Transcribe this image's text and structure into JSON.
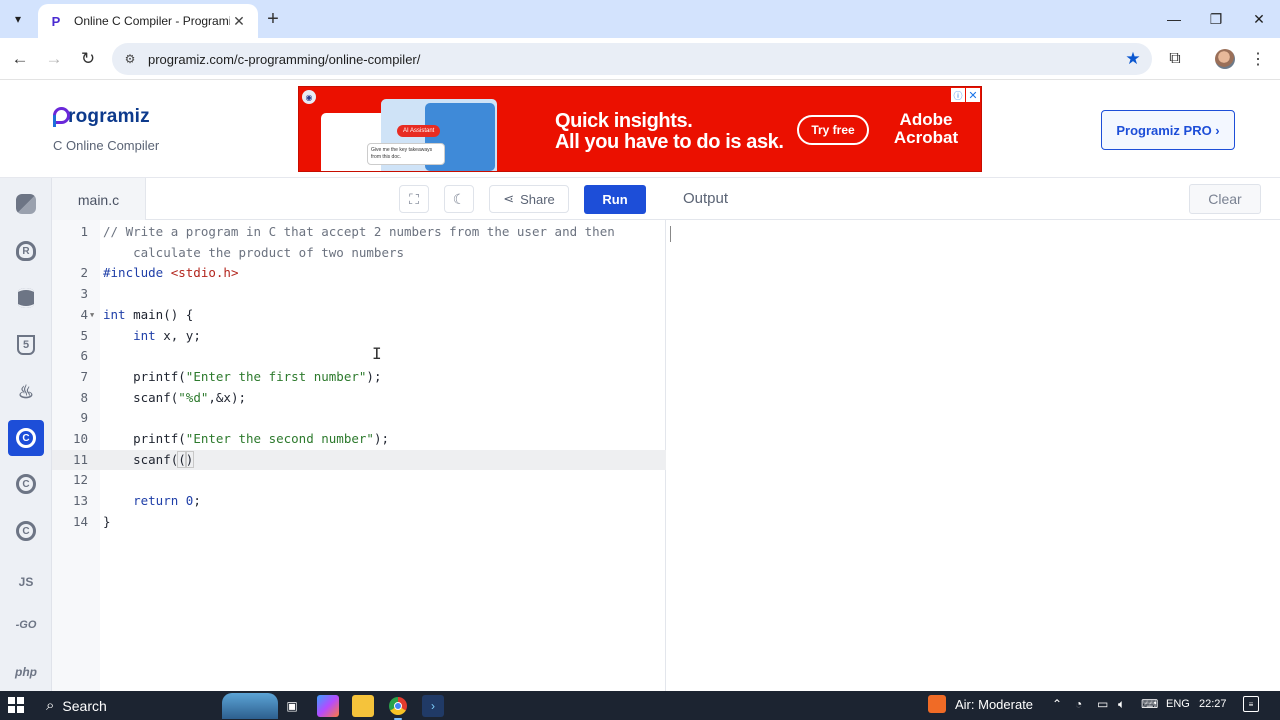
{
  "browser": {
    "tab_title": "Online C Compiler - Programiz",
    "url": "programiz.com/c-programming/online-compiler/"
  },
  "site": {
    "logo_text": "rogramiz",
    "subtitle": "C Online Compiler",
    "pro_button": "Programiz PRO ›"
  },
  "ad": {
    "headline_line1": "Quick insights.",
    "headline_line2": "All you have to do is ask.",
    "cta": "Try free",
    "brand_line1": "Adobe",
    "brand_line2": "Acrobat",
    "chip_text": "AI Assistant",
    "bubble_text": "Give me the key takeaways from this doc."
  },
  "sidebar": {
    "items": [
      {
        "name": "python",
        "icon": "python-icon",
        "label": ""
      },
      {
        "name": "r",
        "icon": "r-icon",
        "label": "R"
      },
      {
        "name": "sql",
        "icon": "database-icon",
        "label": ""
      },
      {
        "name": "html",
        "icon": "html5-icon",
        "label": "5"
      },
      {
        "name": "java",
        "icon": "java-icon",
        "label": ""
      },
      {
        "name": "c",
        "icon": "c-icon",
        "label": "C",
        "active": true
      },
      {
        "name": "cpp",
        "icon": "cpp-icon",
        "label": "C"
      },
      {
        "name": "csharp",
        "icon": "csharp-icon",
        "label": "C"
      },
      {
        "name": "js",
        "icon": "js-icon",
        "label": "JS"
      },
      {
        "name": "go",
        "icon": "go-icon",
        "label": "-GO"
      },
      {
        "name": "php",
        "icon": "php-icon",
        "label": "php"
      }
    ]
  },
  "editor": {
    "file_name": "main.c",
    "share_label": "Share",
    "run_label": "Run",
    "active_line": 11,
    "lines": [
      {
        "n": "1",
        "parts": [
          [
            "c-com",
            "// Write a program in C that accept 2 numbers from the user and then"
          ]
        ]
      },
      {
        "n": "",
        "parts": [
          [
            "c-com",
            "    calculate the product of two numbers"
          ]
        ]
      },
      {
        "n": "2",
        "parts": [
          [
            "c-inc",
            "#include "
          ],
          [
            "c-hdr",
            "<stdio.h>"
          ]
        ]
      },
      {
        "n": "3",
        "parts": []
      },
      {
        "n": "4",
        "fold": true,
        "parts": [
          [
            "c-kw",
            "int"
          ],
          [
            "",
            " main() {"
          ]
        ]
      },
      {
        "n": "5",
        "parts": [
          [
            "",
            "    "
          ],
          [
            "c-kw",
            "int"
          ],
          [
            "",
            " x, y;"
          ]
        ]
      },
      {
        "n": "6",
        "parts": []
      },
      {
        "n": "7",
        "parts": [
          [
            "",
            "    printf("
          ],
          [
            "c-str",
            "\"Enter the first number\""
          ],
          [
            "",
            ");"
          ]
        ]
      },
      {
        "n": "8",
        "parts": [
          [
            "",
            "    scanf("
          ],
          [
            "c-str",
            "\"%d\""
          ],
          [
            "",
            ",&x);"
          ]
        ]
      },
      {
        "n": "9",
        "parts": []
      },
      {
        "n": "10",
        "parts": [
          [
            "",
            "    printf("
          ],
          [
            "c-str",
            "\"Enter the second number\""
          ],
          [
            "",
            ");"
          ]
        ]
      },
      {
        "n": "11",
        "parts": [
          [
            "",
            "    scanf("
          ],
          [
            "bracket",
            ")"
          ]
        ]
      },
      {
        "n": "12",
        "parts": []
      },
      {
        "n": "13",
        "parts": [
          [
            "",
            "    "
          ],
          [
            "c-kw",
            "return"
          ],
          [
            "",
            " "
          ],
          [
            "c-num",
            "0"
          ],
          [
            "",
            ";"
          ]
        ]
      },
      {
        "n": "14",
        "parts": [
          [
            "",
            "}"
          ]
        ]
      }
    ]
  },
  "output": {
    "title": "Output",
    "clear_label": "Clear"
  },
  "taskbar": {
    "search_label": "Search",
    "weather": "Air: Moderate",
    "language": "ENG",
    "time": "22:27"
  },
  "colors": {
    "brand_blue": "#1d4ed8",
    "ad_red": "#eb1000",
    "tabstrip": "#d3e3fd",
    "taskbar": "#1c2431"
  }
}
